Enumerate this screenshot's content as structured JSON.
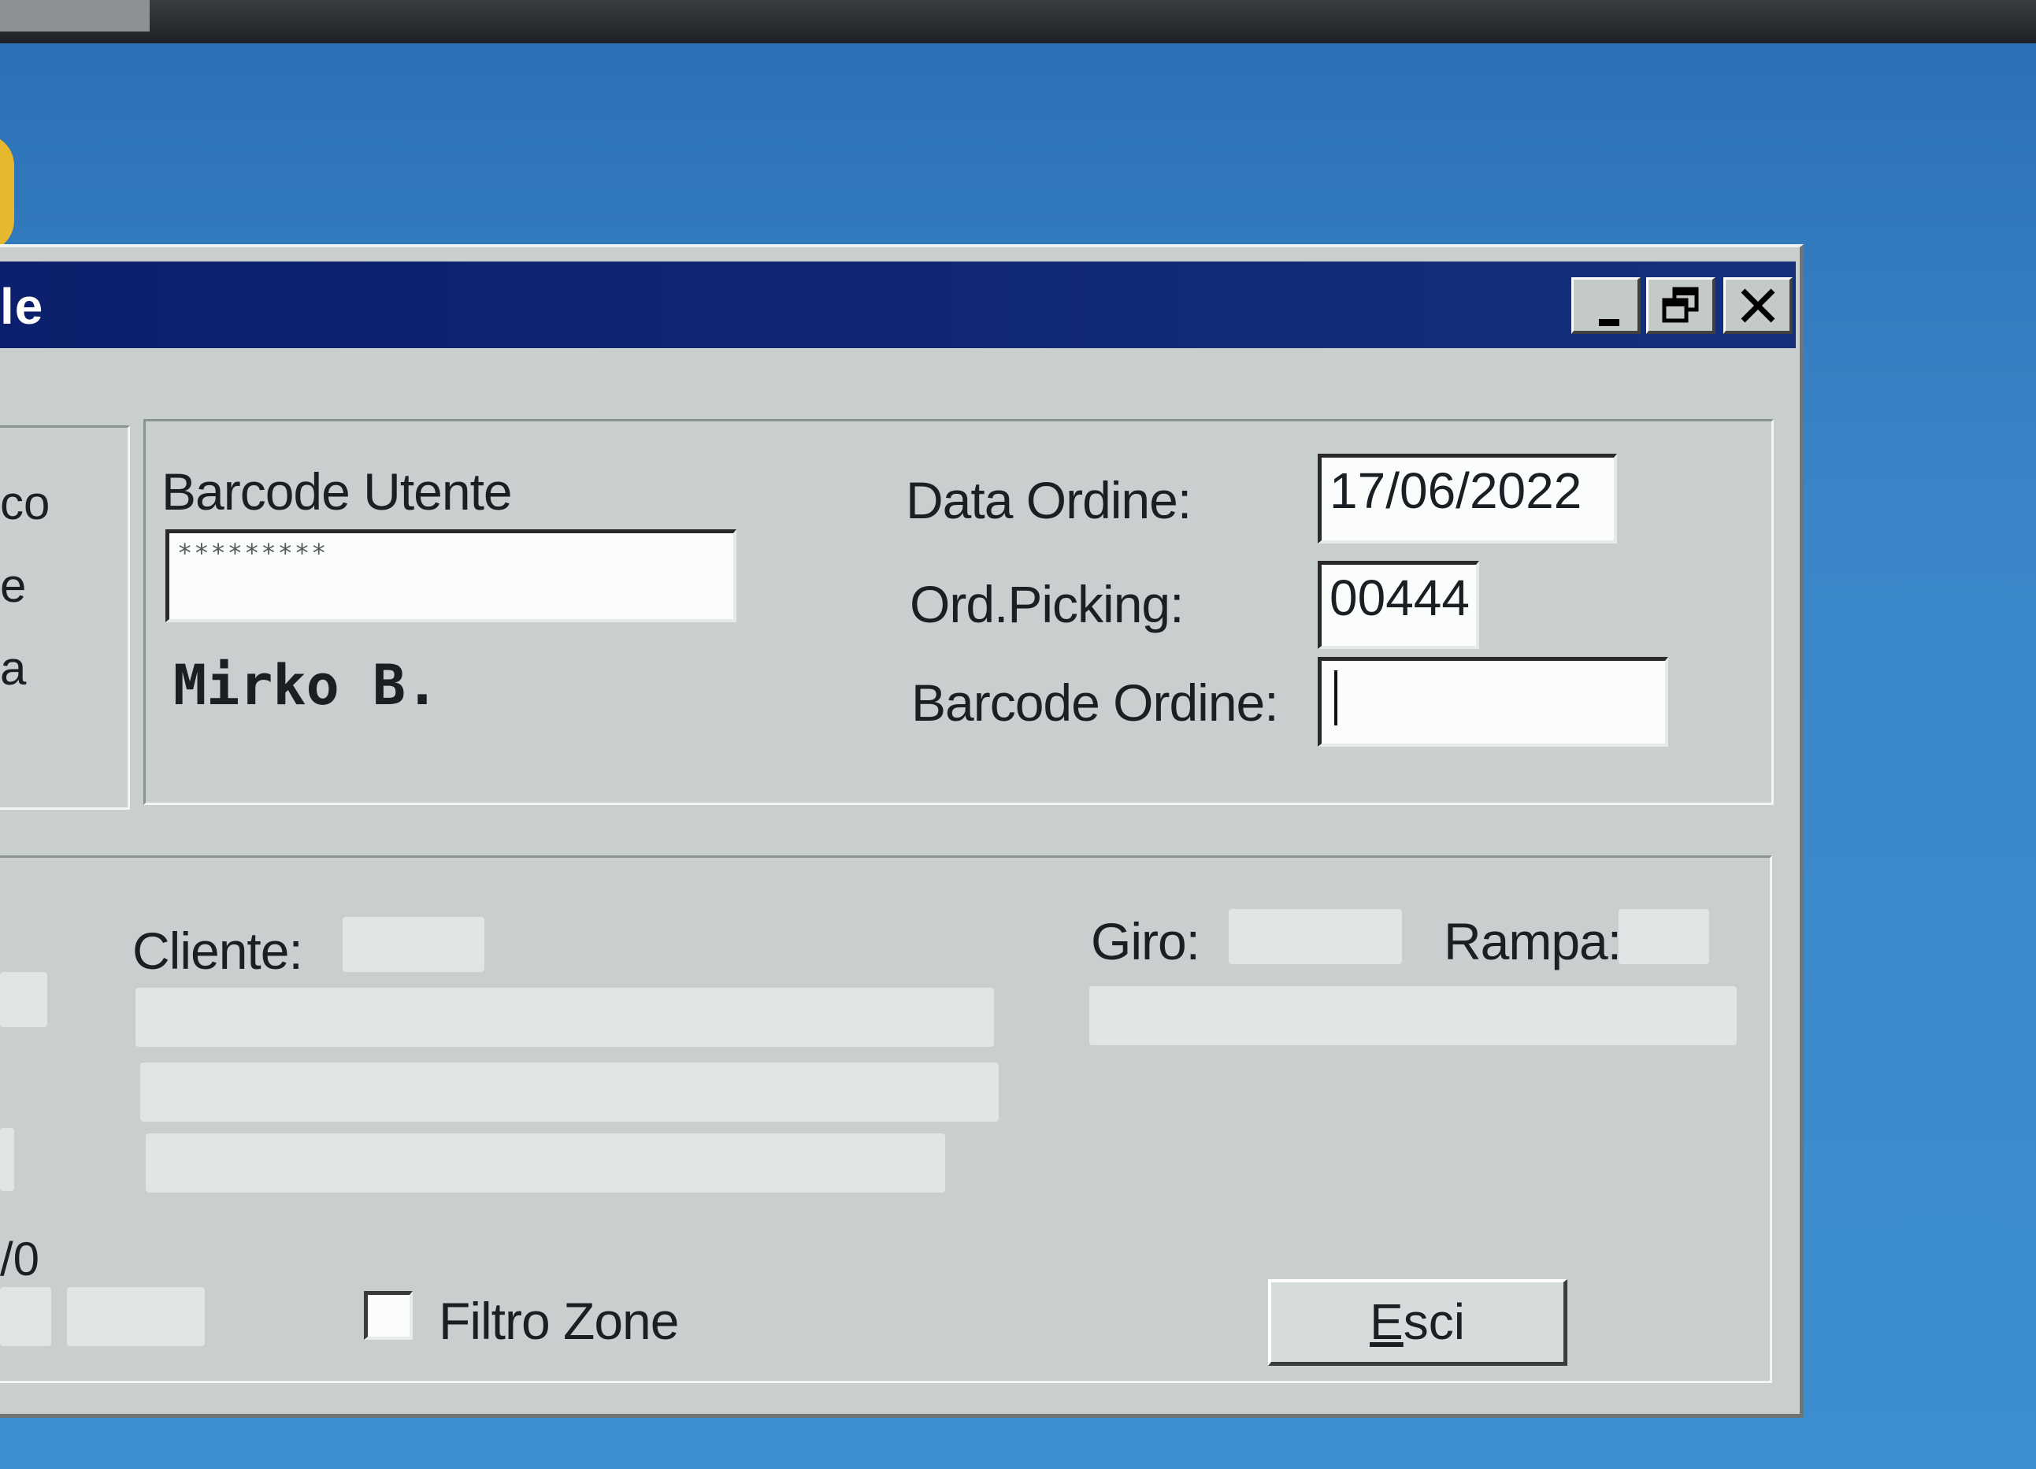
{
  "window": {
    "title": "le",
    "controls": {
      "minimize_icon": "minimize-icon",
      "restore_icon": "restore-icon",
      "close_icon": "close-icon"
    }
  },
  "side_labels": [
    "co",
    "e",
    "a",
    "/0"
  ],
  "login": {
    "barcode_utente_label": "Barcode Utente",
    "barcode_utente_value": "*********",
    "user_name": "Mirko B."
  },
  "order": {
    "data_ordine_label": "Data Ordine:",
    "data_ordine_value": "17/06/2022",
    "ord_picking_label": "Ord.Picking:",
    "ord_picking_value": "00444",
    "barcode_ordine_label": "Barcode Ordine:",
    "barcode_ordine_value": ""
  },
  "details": {
    "cliente_label": "Cliente:",
    "giro_label": "Giro:",
    "rampa_label": "Rampa:"
  },
  "filtro_zone": {
    "label": "Filtro Zone",
    "checked": false
  },
  "esci_button": {
    "mnemonic": "E",
    "rest": "sci"
  }
}
